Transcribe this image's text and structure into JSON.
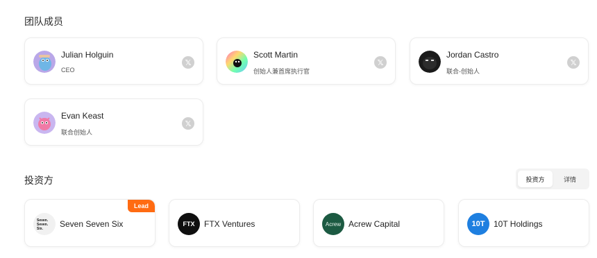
{
  "team": {
    "title": "团队成员",
    "members": [
      {
        "name": "Julian Holguin",
        "role": "CEO",
        "avatar": "blue-creature-avatar"
      },
      {
        "name": "Scott Martin",
        "role": "创始人兼首席执行官",
        "avatar": "rainbow-avatar"
      },
      {
        "name": "Jordan Castro",
        "role": "联合-创始人",
        "avatar": "dark-avatar"
      },
      {
        "name": "Evan Keast",
        "role": "联合创始人",
        "avatar": "pink-creature-avatar"
      }
    ],
    "social_icon": "x-icon"
  },
  "investors": {
    "title": "投资方",
    "toggle": {
      "active": "投资方",
      "inactive": "详情"
    },
    "items": [
      {
        "name": "Seven Seven Six",
        "logo_text": "Seven Seven Six",
        "badge": "Lead"
      },
      {
        "name": "FTX Ventures",
        "logo_text": "FTX"
      },
      {
        "name": "Acrew Capital",
        "logo_text": "Acrew"
      },
      {
        "name": "10T Holdings",
        "logo_text": "10T"
      }
    ]
  },
  "colors": {
    "lead_badge": "#ff6b12",
    "x_button": "#d0d0d0"
  }
}
